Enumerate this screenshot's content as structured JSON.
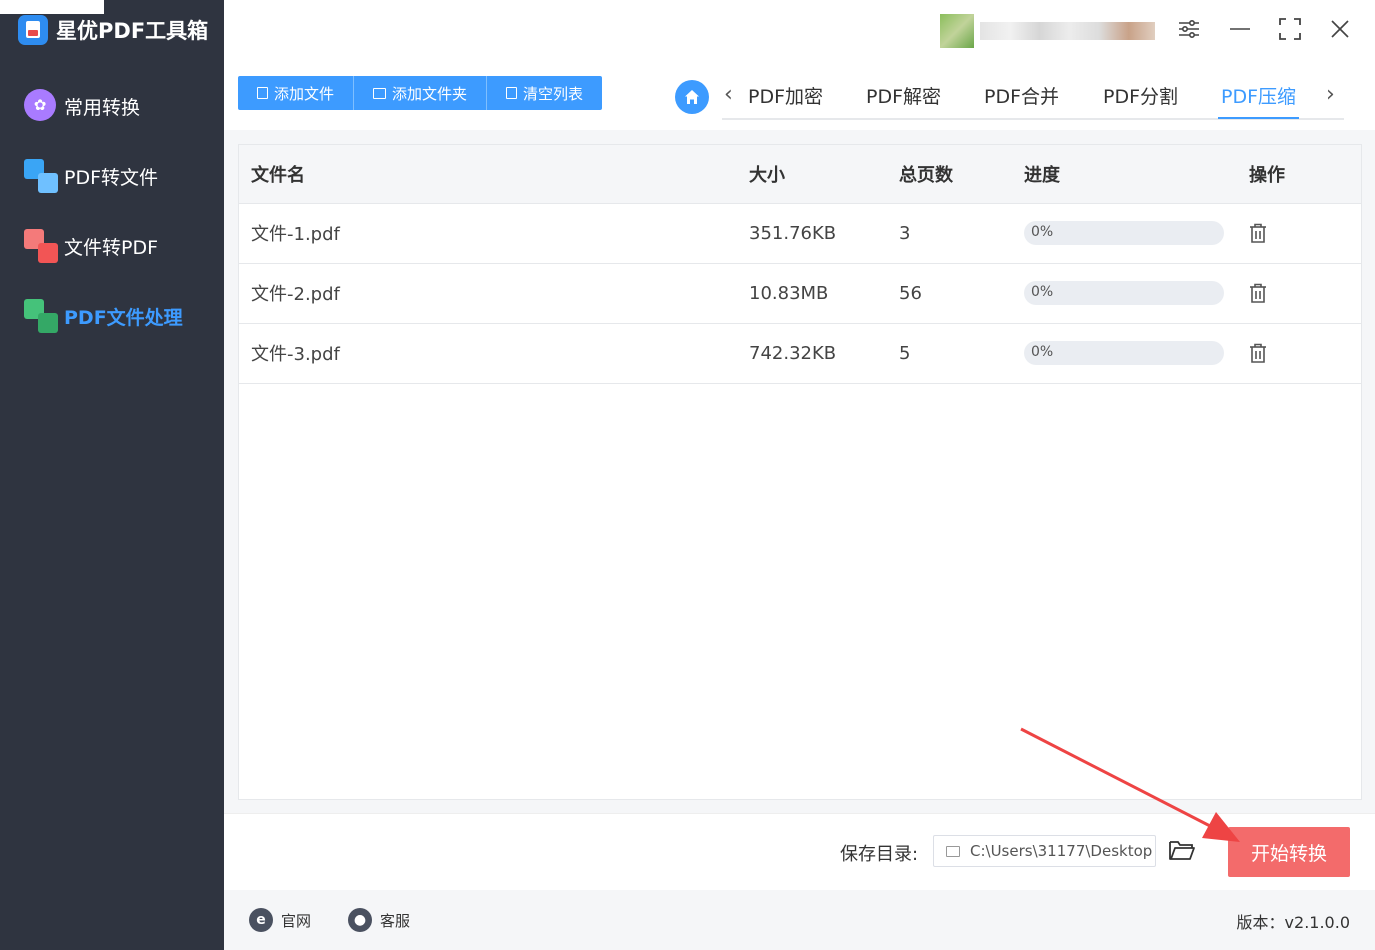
{
  "app": {
    "title": "星优PDF工具箱"
  },
  "sidebar": {
    "items": [
      {
        "label": "常用转换",
        "icon": "apps-icon",
        "active": false
      },
      {
        "label": "PDF转文件",
        "icon": "pdf-to-file-icon",
        "active": false
      },
      {
        "label": "文件转PDF",
        "icon": "file-to-pdf-icon",
        "active": false
      },
      {
        "label": "PDF文件处理",
        "icon": "pdf-process-icon",
        "active": true
      }
    ]
  },
  "window_controls": {
    "settings": "settings-icon",
    "minimize": "minimize-icon",
    "maximize": "maximize-icon",
    "close": "close-icon"
  },
  "toolbar": {
    "add_file": "添加文件",
    "add_folder": "添加文件夹",
    "clear_list": "清空列表"
  },
  "tabs": {
    "items": [
      {
        "label": "PDF加密",
        "active": false
      },
      {
        "label": "PDF解密",
        "active": false
      },
      {
        "label": "PDF合并",
        "active": false
      },
      {
        "label": "PDF分割",
        "active": false
      },
      {
        "label": "PDF压缩",
        "active": true
      }
    ]
  },
  "table": {
    "headers": {
      "name": "文件名",
      "size": "大小",
      "pages": "总页数",
      "progress": "进度",
      "action": "操作"
    },
    "rows": [
      {
        "name": "文件-1.pdf",
        "size": "351.76KB",
        "pages": "3",
        "progress": "0%",
        "progress_value": 0
      },
      {
        "name": "文件-2.pdf",
        "size": "10.83MB",
        "pages": "56",
        "progress": "0%",
        "progress_value": 0
      },
      {
        "name": "文件-3.pdf",
        "size": "742.32KB",
        "pages": "5",
        "progress": "0%",
        "progress_value": 0
      }
    ]
  },
  "bottom": {
    "save_label": "保存目录:",
    "save_path": "C:\\Users\\31177\\Desktop",
    "start_button": "开始转换"
  },
  "footer": {
    "website": "官网",
    "support": "客服",
    "version": "版本：v2.1.0.0"
  },
  "colors": {
    "accent": "#3d9bff",
    "sidebar_bg": "#2f3440",
    "start_button": "#f36b6b",
    "arrow": "#ee4444"
  }
}
